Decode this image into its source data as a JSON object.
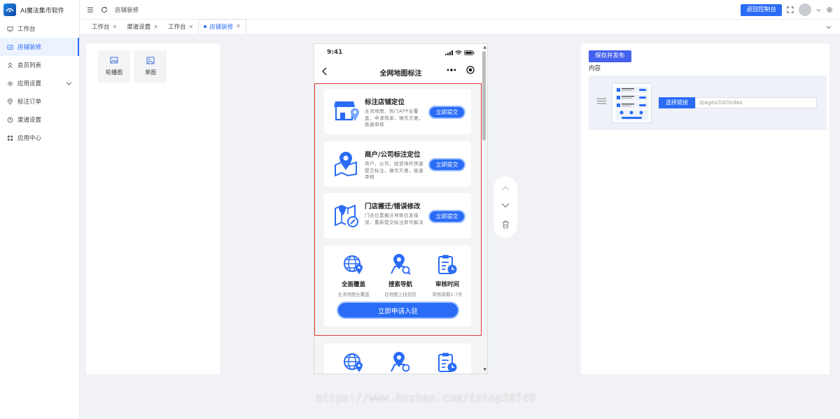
{
  "app": {
    "title": "AI魔法集市软件"
  },
  "sidebar": {
    "items": [
      {
        "label": "工作台",
        "icon": "monitor-icon",
        "active": false
      },
      {
        "label": "店铺装修",
        "icon": "palette-icon",
        "active": true
      },
      {
        "label": "会员列表",
        "icon": "user-icon",
        "active": false
      },
      {
        "label": "应用设置",
        "icon": "gear-icon",
        "active": false,
        "expandable": true
      },
      {
        "label": "标注订单",
        "icon": "location-icon",
        "active": false
      },
      {
        "label": "渠道设置",
        "icon": "clock-icon",
        "active": false
      },
      {
        "label": "应用中心",
        "icon": "grid-icon",
        "active": false
      }
    ]
  },
  "topbar": {
    "breadcrumb": "店铺装修",
    "return_label": "返回控制台"
  },
  "tabs": [
    {
      "label": "工作台",
      "active": false
    },
    {
      "label": "渠道设置",
      "active": false
    },
    {
      "label": "工作台",
      "active": false
    },
    {
      "label": "店铺装修",
      "active": true
    }
  ],
  "components": [
    {
      "label": "轮播图",
      "icon": "image-icon"
    },
    {
      "label": "单图",
      "icon": "picture-icon"
    }
  ],
  "phone": {
    "time": "9:41",
    "page_title": "全网地图标注",
    "cards": [
      {
        "title": "标注店铺定位",
        "desc": "主流地图、热门APP全覆盖，申请简单，操作方便，极速审核",
        "button": "立即提交",
        "icon": "store-pin-icon"
      },
      {
        "title": "商户/公司标注定位",
        "desc": "商户、公司、经营场所快速提交标注，操作方便，极速审核",
        "button": "立即提交",
        "icon": "map-pin-icon"
      },
      {
        "title": "门店搬迁/错误修改",
        "desc": "门店位置搬迁导致信息错误，重新提交标注即可解决",
        "button": "立即提交",
        "icon": "map-edit-icon"
      }
    ],
    "features": [
      {
        "name": "全面覆盖",
        "desc": "主流地图全覆盖",
        "icon": "globe-pin-icon"
      },
      {
        "name": "搜索导航",
        "desc": "在地图上找到您",
        "icon": "search-nav-icon"
      },
      {
        "name": "审核时间",
        "desc": "审核周期1-7天",
        "icon": "clipboard-clock-icon"
      }
    ],
    "apply_label": "立即申请入驻"
  },
  "right_panel": {
    "publish_label": "保存并发布",
    "content_label": "内容",
    "link_button": "选择链接",
    "link_value": "/pages/list/index"
  },
  "watermark": "https://www.huzhan.com/ishop38749",
  "colors": {
    "primary": "#2a6cf6",
    "highlight": "#e23b3b",
    "publish": "#4361ee"
  }
}
